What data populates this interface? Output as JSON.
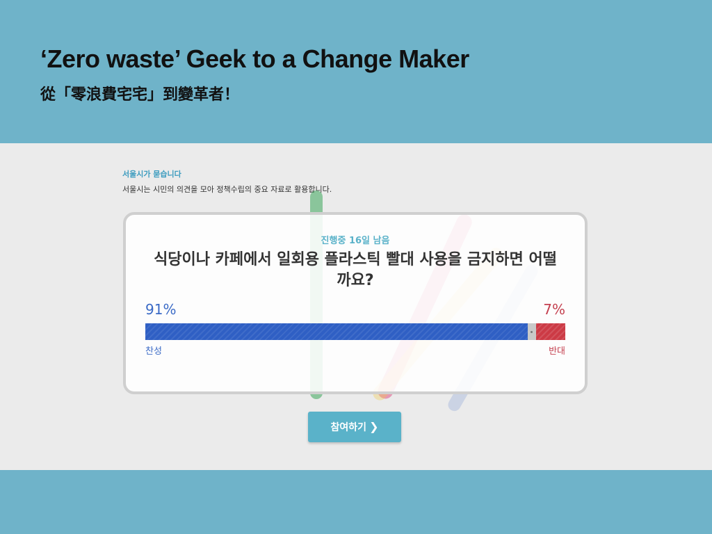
{
  "slide": {
    "title": "‘Zero waste’ Geek to a Change Maker",
    "subtitle": "從「零浪費宅宅」到變革者！"
  },
  "header": {
    "label": "서울시가 묻습니다",
    "description": "서울시는 시민의 의견을 모아 정책수립의 중요 자료로 활용합니다."
  },
  "poll": {
    "status": "진행중 16일 남음",
    "question": "식당이나 카페에서 일회용 플라스틱 빨대 사용을 금지하면 어떨까요?",
    "yes_percent_text": "91%",
    "no_percent_text": "7%",
    "yes_percent": 91,
    "neutral_percent": 2,
    "no_percent": 7,
    "yes_label": "찬성",
    "no_label": "반대",
    "colors": {
      "yes": "#2f5fc4",
      "no": "#cc3a45",
      "neutral": "#c9c9c9",
      "accent": "#5ab2c9"
    }
  },
  "participate_button": {
    "label": "참여하기",
    "icon": "chevron-right-icon"
  }
}
